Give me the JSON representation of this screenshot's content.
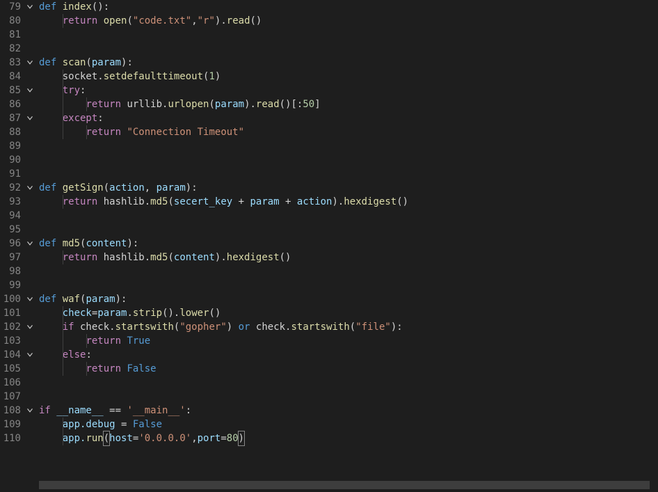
{
  "editor": {
    "language": "python",
    "first_line_no": 79,
    "lines": [
      {
        "no": 79,
        "fold": true,
        "tokens": [
          {
            "t": "def ",
            "c": "kw"
          },
          {
            "t": "index",
            "c": "fn"
          },
          {
            "t": "():",
            "c": "pun"
          }
        ]
      },
      {
        "no": 80,
        "tokens": [
          {
            "t": "    ",
            "c": ""
          },
          {
            "t": "return",
            "c": "kw2"
          },
          {
            "t": " ",
            "c": ""
          },
          {
            "t": "open",
            "c": "fn"
          },
          {
            "t": "(",
            "c": "pun"
          },
          {
            "t": "\"code.txt\"",
            "c": "str"
          },
          {
            "t": ",",
            "c": "pun"
          },
          {
            "t": "\"r\"",
            "c": "str"
          },
          {
            "t": ").",
            "c": "pun"
          },
          {
            "t": "read",
            "c": "fn"
          },
          {
            "t": "()",
            "c": "pun"
          }
        ]
      },
      {
        "no": 81,
        "tokens": []
      },
      {
        "no": 82,
        "tokens": []
      },
      {
        "no": 83,
        "fold": true,
        "tokens": [
          {
            "t": "def ",
            "c": "kw"
          },
          {
            "t": "scan",
            "c": "fn"
          },
          {
            "t": "(",
            "c": "pun"
          },
          {
            "t": "param",
            "c": "pr"
          },
          {
            "t": "):",
            "c": "pun"
          }
        ]
      },
      {
        "no": 84,
        "tokens": [
          {
            "t": "    ",
            "c": ""
          },
          {
            "t": "socket.",
            "c": "dim"
          },
          {
            "t": "setdefaulttimeout",
            "c": "fn"
          },
          {
            "t": "(",
            "c": "pun"
          },
          {
            "t": "1",
            "c": "num"
          },
          {
            "t": ")",
            "c": "pun"
          }
        ]
      },
      {
        "no": 85,
        "fold": true,
        "tokens": [
          {
            "t": "    ",
            "c": ""
          },
          {
            "t": "try",
            "c": "kw2"
          },
          {
            "t": ":",
            "c": "pun"
          }
        ]
      },
      {
        "no": 86,
        "tokens": [
          {
            "t": "        ",
            "c": ""
          },
          {
            "t": "return",
            "c": "kw2"
          },
          {
            "t": " urllib.",
            "c": "dim"
          },
          {
            "t": "urlopen",
            "c": "fn"
          },
          {
            "t": "(",
            "c": "pun"
          },
          {
            "t": "param",
            "c": "pr"
          },
          {
            "t": ").",
            "c": "pun"
          },
          {
            "t": "read",
            "c": "fn"
          },
          {
            "t": "()[:",
            "c": "pun"
          },
          {
            "t": "50",
            "c": "num"
          },
          {
            "t": "]",
            "c": "pun"
          }
        ]
      },
      {
        "no": 87,
        "fold": true,
        "tokens": [
          {
            "t": "    ",
            "c": ""
          },
          {
            "t": "except",
            "c": "kw2"
          },
          {
            "t": ":",
            "c": "pun"
          }
        ]
      },
      {
        "no": 88,
        "tokens": [
          {
            "t": "        ",
            "c": ""
          },
          {
            "t": "return",
            "c": "kw2"
          },
          {
            "t": " ",
            "c": ""
          },
          {
            "t": "\"Connection Timeout\"",
            "c": "str"
          }
        ]
      },
      {
        "no": 89,
        "tokens": []
      },
      {
        "no": 90,
        "tokens": []
      },
      {
        "no": 91,
        "tokens": []
      },
      {
        "no": 92,
        "fold": true,
        "tokens": [
          {
            "t": "def ",
            "c": "kw"
          },
          {
            "t": "getSign",
            "c": "fn"
          },
          {
            "t": "(",
            "c": "pun"
          },
          {
            "t": "action",
            "c": "pr"
          },
          {
            "t": ", ",
            "c": "pun"
          },
          {
            "t": "param",
            "c": "pr"
          },
          {
            "t": "):",
            "c": "pun"
          }
        ]
      },
      {
        "no": 93,
        "tokens": [
          {
            "t": "    ",
            "c": ""
          },
          {
            "t": "return",
            "c": "kw2"
          },
          {
            "t": " hashlib.",
            "c": "dim"
          },
          {
            "t": "md5",
            "c": "fn"
          },
          {
            "t": "(",
            "c": "pun"
          },
          {
            "t": "secert_key ",
            "c": "pr"
          },
          {
            "t": "+ ",
            "c": "pun"
          },
          {
            "t": "param ",
            "c": "pr"
          },
          {
            "t": "+ ",
            "c": "pun"
          },
          {
            "t": "action",
            "c": "pr"
          },
          {
            "t": ").",
            "c": "pun"
          },
          {
            "t": "hexdigest",
            "c": "fn"
          },
          {
            "t": "()",
            "c": "pun"
          }
        ]
      },
      {
        "no": 94,
        "tokens": []
      },
      {
        "no": 95,
        "tokens": []
      },
      {
        "no": 96,
        "fold": true,
        "tokens": [
          {
            "t": "def ",
            "c": "kw"
          },
          {
            "t": "md5",
            "c": "fn"
          },
          {
            "t": "(",
            "c": "pun"
          },
          {
            "t": "content",
            "c": "pr"
          },
          {
            "t": "):",
            "c": "pun"
          }
        ]
      },
      {
        "no": 97,
        "tokens": [
          {
            "t": "    ",
            "c": ""
          },
          {
            "t": "return",
            "c": "kw2"
          },
          {
            "t": " hashlib.",
            "c": "dim"
          },
          {
            "t": "md5",
            "c": "fn"
          },
          {
            "t": "(",
            "c": "pun"
          },
          {
            "t": "content",
            "c": "pr"
          },
          {
            "t": ").",
            "c": "pun"
          },
          {
            "t": "hexdigest",
            "c": "fn"
          },
          {
            "t": "()",
            "c": "pun"
          }
        ]
      },
      {
        "no": 98,
        "tokens": []
      },
      {
        "no": 99,
        "tokens": []
      },
      {
        "no": 100,
        "fold": true,
        "tokens": [
          {
            "t": "def ",
            "c": "kw"
          },
          {
            "t": "waf",
            "c": "fn"
          },
          {
            "t": "(",
            "c": "pun"
          },
          {
            "t": "param",
            "c": "pr"
          },
          {
            "t": "):",
            "c": "pun"
          }
        ]
      },
      {
        "no": 101,
        "tokens": [
          {
            "t": "    ",
            "c": ""
          },
          {
            "t": "check",
            "c": "pr"
          },
          {
            "t": "=",
            "c": "pun"
          },
          {
            "t": "param",
            "c": "pr"
          },
          {
            "t": ".",
            "c": "pun"
          },
          {
            "t": "strip",
            "c": "fn"
          },
          {
            "t": "().",
            "c": "pun"
          },
          {
            "t": "lower",
            "c": "fn"
          },
          {
            "t": "()",
            "c": "pun"
          }
        ]
      },
      {
        "no": 102,
        "fold": true,
        "tokens": [
          {
            "t": "    ",
            "c": ""
          },
          {
            "t": "if",
            "c": "kw2"
          },
          {
            "t": " check.",
            "c": "dim"
          },
          {
            "t": "startswith",
            "c": "fn"
          },
          {
            "t": "(",
            "c": "pun"
          },
          {
            "t": "\"gopher\"",
            "c": "str"
          },
          {
            "t": ") ",
            "c": "pun"
          },
          {
            "t": "or",
            "c": "kw"
          },
          {
            "t": " check.",
            "c": "dim"
          },
          {
            "t": "startswith",
            "c": "fn"
          },
          {
            "t": "(",
            "c": "pun"
          },
          {
            "t": "\"file\"",
            "c": "str"
          },
          {
            "t": "):",
            "c": "pun"
          }
        ]
      },
      {
        "no": 103,
        "tokens": [
          {
            "t": "        ",
            "c": ""
          },
          {
            "t": "return",
            "c": "kw2"
          },
          {
            "t": " ",
            "c": ""
          },
          {
            "t": "True",
            "c": "bool"
          }
        ]
      },
      {
        "no": 104,
        "fold": true,
        "tokens": [
          {
            "t": "    ",
            "c": ""
          },
          {
            "t": "else",
            "c": "kw2"
          },
          {
            "t": ":",
            "c": "pun"
          }
        ]
      },
      {
        "no": 105,
        "tokens": [
          {
            "t": "        ",
            "c": ""
          },
          {
            "t": "return",
            "c": "kw2"
          },
          {
            "t": " ",
            "c": ""
          },
          {
            "t": "False",
            "c": "bool"
          }
        ]
      },
      {
        "no": 106,
        "tokens": []
      },
      {
        "no": 107,
        "tokens": []
      },
      {
        "no": 108,
        "fold": true,
        "tokens": [
          {
            "t": "if",
            "c": "kw2"
          },
          {
            "t": " __name__ ",
            "c": "pr"
          },
          {
            "t": "==",
            "c": "pun"
          },
          {
            "t": " ",
            "c": ""
          },
          {
            "t": "'__main__'",
            "c": "str"
          },
          {
            "t": ":",
            "c": "pun"
          }
        ]
      },
      {
        "no": 109,
        "tokens": [
          {
            "t": "    ",
            "c": ""
          },
          {
            "t": "app.debug ",
            "c": "pr"
          },
          {
            "t": "= ",
            "c": "pun"
          },
          {
            "t": "False",
            "c": "bool"
          }
        ]
      },
      {
        "no": 110,
        "tokens": [
          {
            "t": "    ",
            "c": ""
          },
          {
            "t": "app.",
            "c": "pr"
          },
          {
            "t": "run",
            "c": "fn"
          },
          {
            "t": "(",
            "c": "pun",
            "box": true
          },
          {
            "t": "host",
            "c": "pr"
          },
          {
            "t": "=",
            "c": "pun"
          },
          {
            "t": "'0.0.0.0'",
            "c": "str"
          },
          {
            "t": ",",
            "c": "pun"
          },
          {
            "t": "port",
            "c": "pr"
          },
          {
            "t": "=",
            "c": "pun"
          },
          {
            "t": "80",
            "c": "num"
          },
          {
            "t": ")",
            "c": "pun",
            "box": true
          }
        ]
      }
    ],
    "indent_guides": [
      {
        "col": 4,
        "start": 80,
        "end": 80
      },
      {
        "col": 4,
        "start": 84,
        "end": 88
      },
      {
        "col": 8,
        "start": 86,
        "end": 86
      },
      {
        "col": 8,
        "start": 88,
        "end": 88
      },
      {
        "col": 4,
        "start": 93,
        "end": 93
      },
      {
        "col": 4,
        "start": 97,
        "end": 97
      },
      {
        "col": 4,
        "start": 101,
        "end": 105
      },
      {
        "col": 8,
        "start": 103,
        "end": 103
      },
      {
        "col": 8,
        "start": 105,
        "end": 105
      },
      {
        "col": 4,
        "start": 109,
        "end": 110
      }
    ]
  }
}
